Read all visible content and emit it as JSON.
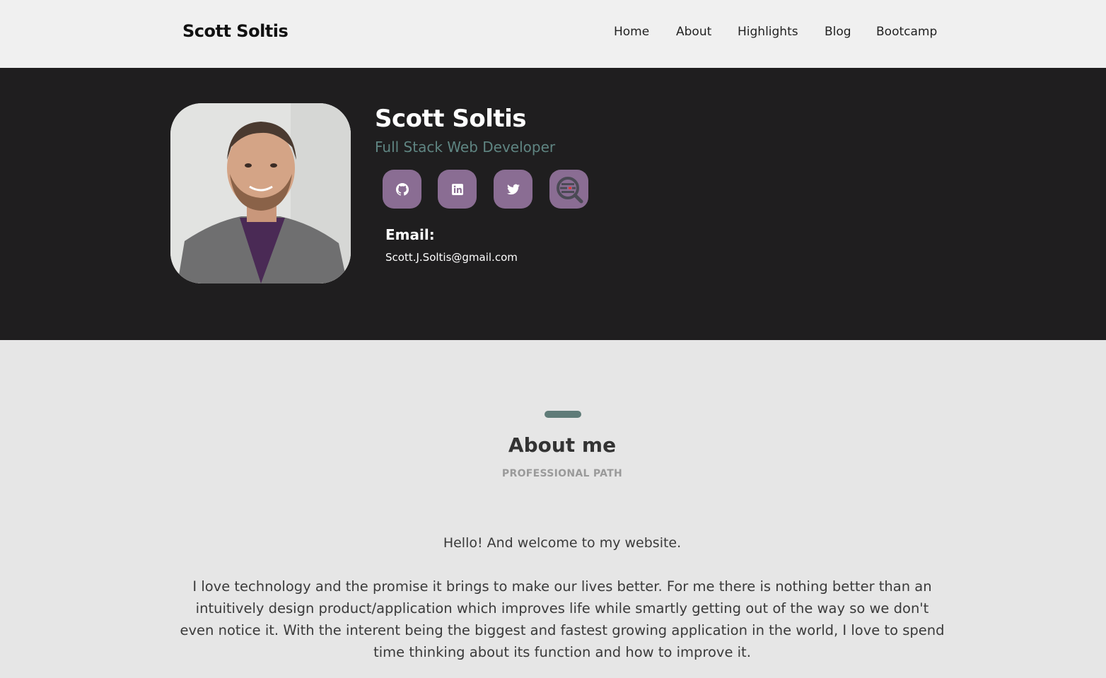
{
  "header": {
    "brand": "Scott Soltis",
    "nav": [
      "Home",
      "About",
      "Highlights",
      "Blog",
      "Bootcamp"
    ]
  },
  "hero": {
    "name": "Scott Soltis",
    "title": "Full Stack Web Developer",
    "social_icons": [
      "github-icon",
      "linkedin-icon",
      "twitter-icon",
      "search-code-icon"
    ],
    "email_label": "Email:",
    "email": "Scott.J.Soltis@gmail.com"
  },
  "about": {
    "title": "About me",
    "subtitle": "PROFESSIONAL PATH",
    "paragraph1": "Hello! And welcome to my website.",
    "paragraph2": "I love technology and the promise it brings to make our lives better. For me there is nothing better than an intuitively design product/application which improves life while smartly getting out of the way so we don't even notice it. With the interent being the biggest and fastest growing application in the world, I love to spend time thinking about its function and how to improve it."
  },
  "colors": {
    "hero_bg": "#1f1e1f",
    "accent_teal": "#5f8582",
    "social_purple": "#8a6d93",
    "page_bg": "#e6e6e6",
    "topbar_bg": "#f0f0f0"
  }
}
